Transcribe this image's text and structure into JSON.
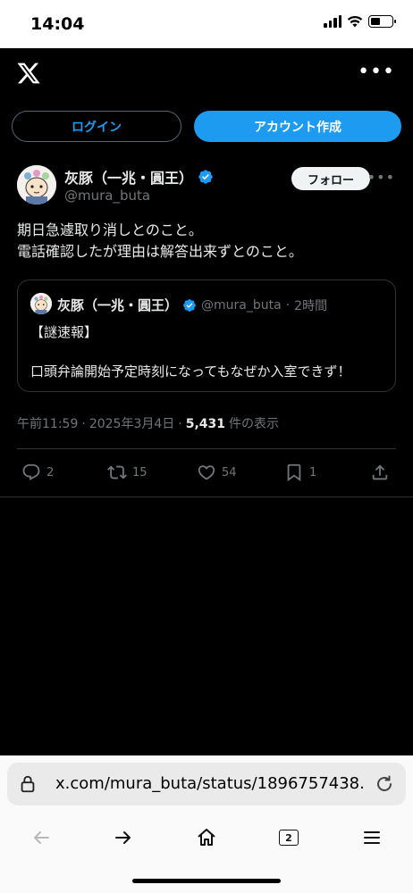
{
  "status_bar": {
    "time": "14:04",
    "battery_level": 0.45
  },
  "header": {
    "logo_icon": "x-logo-icon",
    "more_icon": "more-horizontal-icon"
  },
  "auth": {
    "login_label": "ログイン",
    "signup_label": "アカウント作成"
  },
  "tweet": {
    "display_name": "灰豚（一兆・圓王）",
    "handle": "@mura_buta",
    "follow_label": "フォロー",
    "text": "期日急遽取り消しとのこと。\n電話確認したが理由は解答出来ずとのこと。",
    "quote": {
      "display_name": "灰豚（一兆・圓王）",
      "handle": "@mura_buta",
      "dot": "·",
      "time": "2時間",
      "text": "【謎速報】\n\n口頭弁論開始予定時刻になってもなぜか入室できず！"
    },
    "meta": {
      "time": "午前11:59",
      "sep1": "·",
      "date": "2025年3月4日",
      "sep2": "·",
      "views": "5,431",
      "views_suffix": "件の表示"
    },
    "actions": {
      "replies": "2",
      "reposts": "15",
      "likes": "54",
      "bookmarks": "1"
    }
  },
  "browser": {
    "url": "x.com/mura_buta/status/1896757438...",
    "tab_count": "2"
  },
  "colors": {
    "accent": "#1d9bf0",
    "background": "#000000",
    "muted": "#71767b"
  }
}
